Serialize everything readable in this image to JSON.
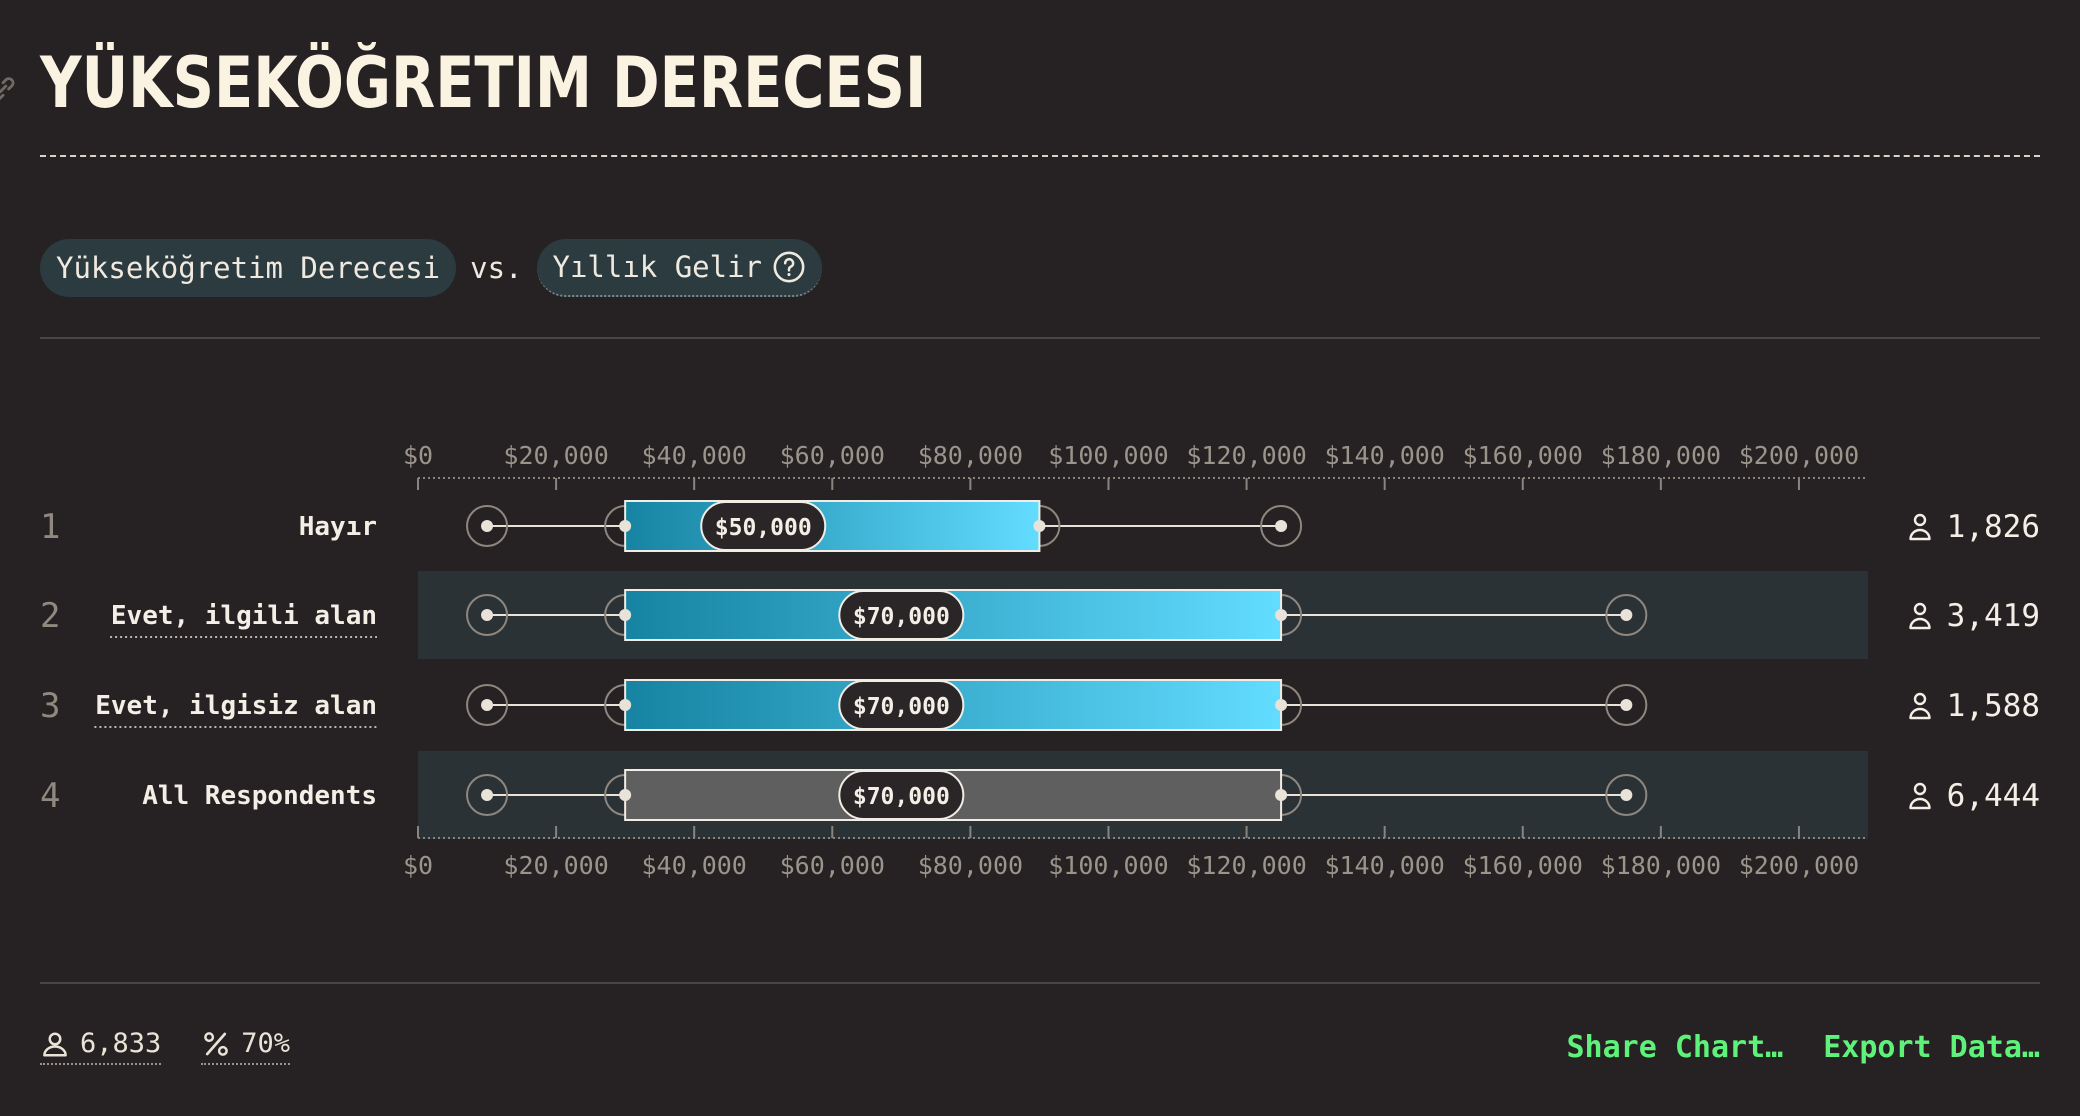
{
  "title": "YÜKSEKÖĞRETIM DERECESI",
  "filters": {
    "primary_label": "Yükseköğretim Derecesi",
    "vs_label": "vs.",
    "secondary_label": "Yıllık Gelir"
  },
  "chart_data": {
    "type": "boxplot",
    "x_axis": {
      "min": 0,
      "max": 210000,
      "ticks": [
        0,
        20000,
        40000,
        60000,
        80000,
        100000,
        120000,
        140000,
        160000,
        180000,
        200000
      ],
      "tick_labels": [
        "$0",
        "$20,000",
        "$40,000",
        "$60,000",
        "$80,000",
        "$100,000",
        "$120,000",
        "$140,000",
        "$160,000",
        "$180,000",
        "$200,000"
      ]
    },
    "rows": [
      {
        "rank": "1",
        "label": "Hayır",
        "underlined": false,
        "whisker_low": 10000,
        "q1": 30000,
        "median": 50000,
        "median_label": "$50,000",
        "q3": 90000,
        "whisker_high": 125000,
        "count": "1,826",
        "highlight": false,
        "style": "gradient"
      },
      {
        "rank": "2",
        "label": "Evet, ilgili alan",
        "underlined": true,
        "whisker_low": 10000,
        "q1": 30000,
        "median": 70000,
        "median_label": "$70,000",
        "q3": 125000,
        "whisker_high": 175000,
        "count": "3,419",
        "highlight": true,
        "style": "gradient"
      },
      {
        "rank": "3",
        "label": "Evet, ilgisiz alan",
        "underlined": true,
        "whisker_low": 10000,
        "q1": 30000,
        "median": 70000,
        "median_label": "$70,000",
        "q3": 125000,
        "whisker_high": 175000,
        "count": "1,588",
        "highlight": false,
        "style": "gradient"
      },
      {
        "rank": "4",
        "label": "All Respondents",
        "underlined": false,
        "whisker_low": 10000,
        "q1": 30000,
        "median": 70000,
        "median_label": "$70,000",
        "q3": 125000,
        "whisker_high": 175000,
        "count": "6,444",
        "highlight": true,
        "style": "gray"
      }
    ]
  },
  "footer": {
    "respondents": "6,833",
    "percent": "70%",
    "share_label": "Share Chart…",
    "export_label": "Export Data…"
  },
  "colors": {
    "background": "#262223",
    "row_highlight": "#2b3236",
    "gradient_start": "#1683a2",
    "gradient_end": "#62dcff",
    "gray_box": "#5f5f5f",
    "accent_green": "#5ff27a"
  }
}
